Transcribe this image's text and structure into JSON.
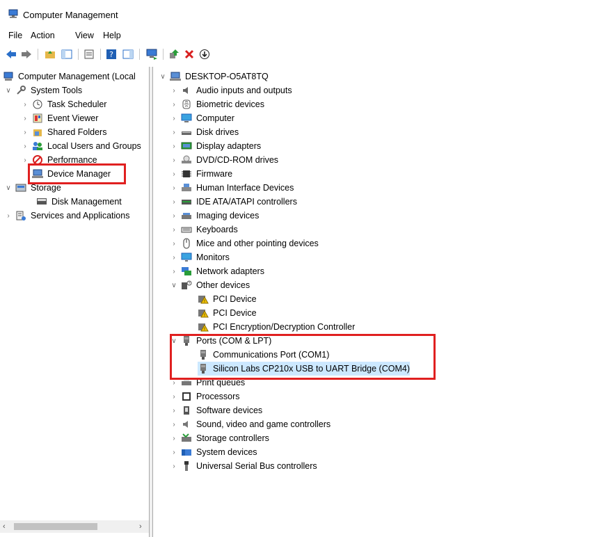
{
  "window": {
    "title": "Computer Management"
  },
  "menu": {
    "file": "File",
    "action": "Action",
    "view": "View",
    "help": "Help"
  },
  "tree": {
    "root": "Computer Management (Local",
    "system_tools": "System Tools",
    "task_scheduler": "Task Scheduler",
    "event_viewer": "Event Viewer",
    "shared_folders": "Shared Folders",
    "local_users": "Local Users and Groups",
    "performance": "Performance",
    "device_manager": "Device Manager",
    "storage": "Storage",
    "disk_management": "Disk Management",
    "services": "Services and Applications"
  },
  "devices": {
    "computer_name": "DESKTOP-O5AT8TQ",
    "categories": [
      "Audio inputs and outputs",
      "Biometric devices",
      "Computer",
      "Disk drives",
      "Display adapters",
      "DVD/CD-ROM drives",
      "Firmware",
      "Human Interface Devices",
      "IDE ATA/ATAPI controllers",
      "Imaging devices",
      "Keyboards",
      "Mice and other pointing devices",
      "Monitors",
      "Network adapters",
      "Other devices",
      "PCI Device",
      "PCI Device",
      "PCI Encryption/Decryption Controller",
      "Ports (COM & LPT)",
      "Communications Port (COM1)",
      "Silicon Labs CP210x USB to UART Bridge (COM4)",
      "Print queues",
      "Processors",
      "Software devices",
      "Sound, video and game controllers",
      "Storage controllers",
      "System devices",
      "Universal Serial Bus controllers"
    ]
  },
  "colors": {
    "highlight": "#e02020",
    "selected": "#cce8ff",
    "accent": "#1a73c9"
  }
}
